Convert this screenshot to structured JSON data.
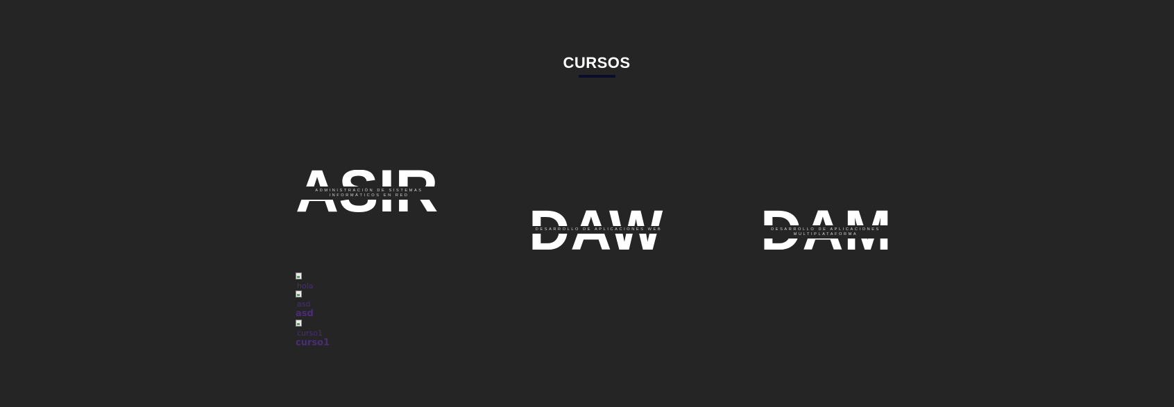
{
  "section": {
    "title": "CURSOS",
    "underline_color": "#0b0b2a"
  },
  "courses": [
    {
      "acronym": "ASIR",
      "subtitle_line1": "ADMINISTRACIÓN DE SISTEMAS",
      "subtitle_line2": "INFORMÁTICOS EN RED"
    },
    {
      "acronym": "DAW",
      "subtitle_line1": "DESARROLLO DE APLICACIONES WEB",
      "subtitle_line2": ""
    },
    {
      "acronym": "DAM",
      "subtitle_line1": "DESARROLLO DE APLICACIONES",
      "subtitle_line2": "MULTIPLATAFORMA"
    }
  ],
  "course_list": [
    {
      "image_alt": "hola",
      "link_label": ""
    },
    {
      "image_alt": "asd",
      "link_label": "asd"
    },
    {
      "image_alt": "curso1",
      "link_label": "curso1"
    }
  ],
  "colors": {
    "background": "#252525",
    "logo_text": "#ffffff",
    "link": "#4a2d78"
  }
}
